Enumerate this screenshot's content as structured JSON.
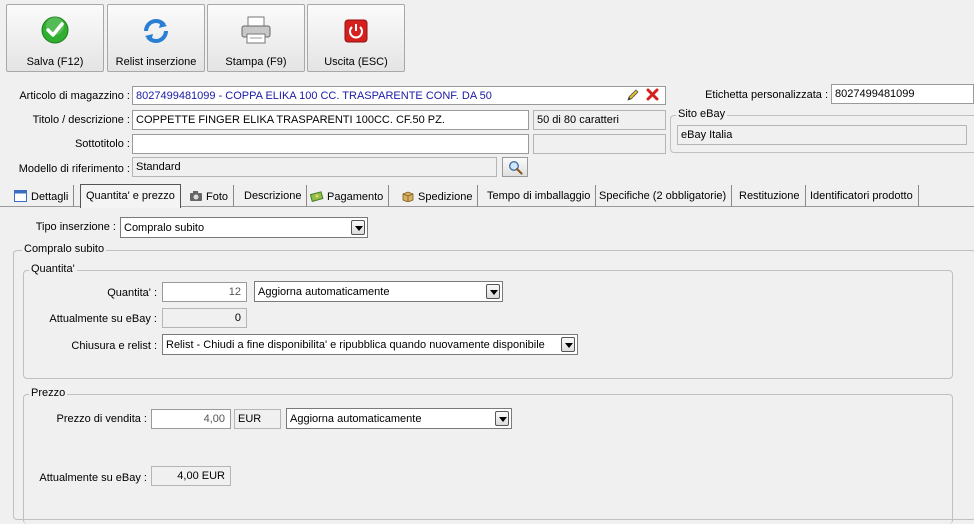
{
  "toolbar": {
    "save": "Salva (F12)",
    "relist": "Relist inserzione",
    "print": "Stampa (F9)",
    "exit": "Uscita (ESC)"
  },
  "header": {
    "articolo_label": "Articolo di magazzino :",
    "articolo_value": "8027499481099 - COPPA ELIKA 100 CC. TRASPARENTE CONF. DA 50",
    "etichetta_label": "Etichetta personalizzata :",
    "etichetta_value": "8027499481099",
    "titolo_label": "Titolo / descrizione :",
    "titolo_value": "COPPETTE FINGER ELIKA TRASPARENTI 100CC. CF.50 PZ.",
    "titolo_counter": "50 di 80 caratteri",
    "sottotitolo_label": "Sottotitolo :",
    "sottotitolo_value": "",
    "sottotitolo_counter": "",
    "sito_title": "Sito eBay",
    "sito_value": "eBay Italia",
    "modello_label": "Modello di riferimento :",
    "modello_value": "Standard"
  },
  "tabs": [
    {
      "label": "Dettagli"
    },
    {
      "label": "Quantita' e prezzo"
    },
    {
      "label": "Foto"
    },
    {
      "label": "Descrizione"
    },
    {
      "label": "Pagamento"
    },
    {
      "label": "Spedizione"
    },
    {
      "label": "Tempo di imballaggio"
    },
    {
      "label": "Specifiche (2 obbligatorie)"
    },
    {
      "label": "Restituzione"
    },
    {
      "label": "Identificatori prodotto"
    }
  ],
  "main": {
    "tipo_label": "Tipo inserzione :",
    "tipo_value": "Compralo subito",
    "compralo_title": "Compralo subito",
    "quantita_group": "Quantita'",
    "quantita_label": "Quantita' :",
    "quantita_value": "12",
    "quantita_mode": "Aggiorna automaticamente",
    "attuale_label": "Attualmente su eBay :",
    "attuale_value": "0",
    "chiusura_label": "Chiusura e relist :",
    "chiusura_value": "Relist - Chiudi a fine disponibilita' e ripubblica quando nuovamente disponibile",
    "prezzo_group": "Prezzo",
    "prezzo_label": "Prezzo di vendita :",
    "prezzo_value": "4,00",
    "prezzo_currency": "EUR",
    "prezzo_mode": "Aggiorna automaticamente",
    "prezzo_attuale_label": "Attualmente su eBay :",
    "prezzo_attuale_value": "4,00 EUR"
  },
  "colors": {
    "articolo_text": "#1a1aa6",
    "save_icon": "#2fae2f",
    "exit_icon": "#d62020",
    "relist_icon": "#2a7fd4"
  }
}
